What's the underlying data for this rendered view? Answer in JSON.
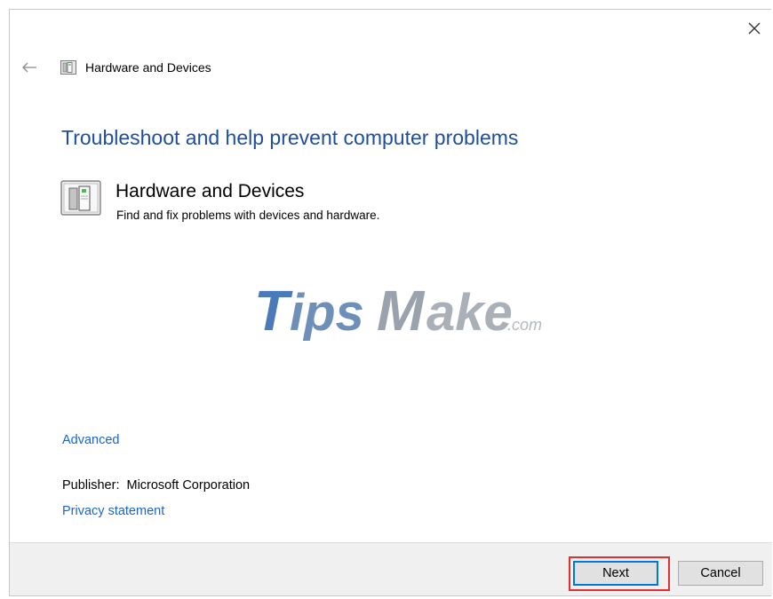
{
  "window": {
    "title": "Hardware and Devices"
  },
  "icons": {
    "close": "close-icon",
    "back": "back-arrow-icon",
    "troubleshooter": "hardware-devices-icon"
  },
  "main": {
    "heading": "Troubleshoot and help prevent computer problems",
    "tool_name": "Hardware and Devices",
    "tool_description": "Find and fix problems with devices and hardware.",
    "advanced_link": "Advanced",
    "publisher_label": "Publisher:",
    "publisher_value": "Microsoft Corporation",
    "privacy_link": "Privacy statement"
  },
  "watermark": {
    "brand": "TipsMake",
    "suffix": ".com"
  },
  "footer": {
    "next_label": "Next",
    "cancel_label": "Cancel"
  },
  "colors": {
    "heading": "#1f4e9c",
    "link": "#1a66c9",
    "highlight": "#e03030",
    "watermark_blue": "#4a7ab8",
    "watermark_gray": "#9aa3ad"
  }
}
